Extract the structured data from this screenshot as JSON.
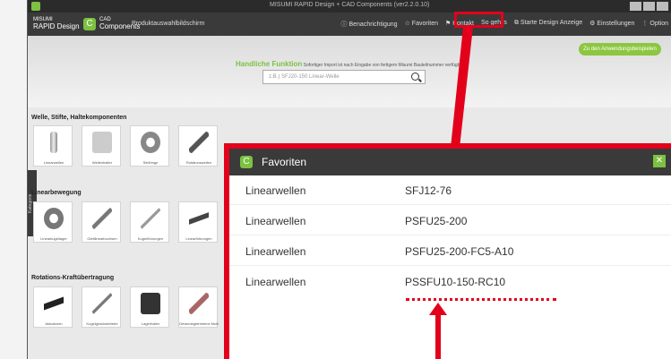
{
  "window": {
    "title": "MISUMI RAPID Design + CAD Components (ver2.2.0.10)"
  },
  "menubar": {
    "brand_top": "MISUMI",
    "brand_bottom": "RAPID Design",
    "brand2_top": "CAD",
    "brand2_bottom": "Components",
    "screen_title": "Produktauswahlbildschirm",
    "items": [
      {
        "label": "Benachrichtigung",
        "icon": "info-icon"
      },
      {
        "label": "Favoriten",
        "icon": "star-icon"
      },
      {
        "label": "Kontakt",
        "icon": "flag-icon"
      },
      {
        "label": "So geht's",
        "icon": "help-icon"
      },
      {
        "label": "Starte Design Anzeige",
        "icon": "external-link-icon"
      },
      {
        "label": "Einstellungen",
        "icon": "gear-icon"
      },
      {
        "label": "Option",
        "icon": "more-icon"
      }
    ]
  },
  "hero": {
    "headline": "Handliche Funktion",
    "subline": "Sofortiger Import ist nach Eingabe von fertigem Misumi Bauteilnummer verfügbar",
    "search_placeholder": "z.B.) SFJ20-150 Linear-Welle",
    "cta": "Zu den Anwendungsbeispielen"
  },
  "sidebar_tab": "Kategorie",
  "sections": [
    {
      "title": "Welle, Stifte, Haltekomponenten",
      "tiles": [
        "Linearwellen",
        "Wellenhalter",
        "Stellringe",
        "Rotationswellen"
      ]
    },
    {
      "title": "Linearbewegung",
      "tiles": [
        "Linearkugellager",
        "Gleitlinearbuchsen",
        "Kugelführungen",
        "Linearführungen"
      ]
    },
    {
      "title": "Rotations-Kraftübertragung",
      "tiles": [
        "Aktuatoren",
        "Kugelgewindetriebe",
        "Lagerhalter",
        "Gewindegetriebene Mutterneinheiten"
      ]
    }
  ],
  "favorites_panel": {
    "title": "Favoriten",
    "rows": [
      {
        "category": "Linearwellen",
        "part": "SFJ12-76"
      },
      {
        "category": "Linearwellen",
        "part": "PSFU25-200"
      },
      {
        "category": "Linearwellen",
        "part": "PSFU25-200-FC5-A10"
      },
      {
        "category": "Linearwellen",
        "part": "PSSFU10-150-RC10"
      }
    ]
  },
  "colors": {
    "accent_green": "#7cc142",
    "highlight_red": "#e3001b",
    "menubar": "#3a3a3a"
  }
}
